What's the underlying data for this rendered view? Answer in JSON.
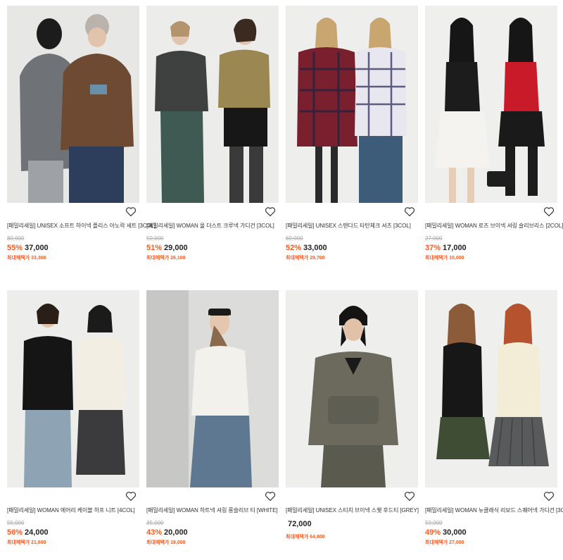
{
  "products": [
    {
      "title": "[패밀리세일] UNISEX 소프트 하이넥 플리스 아노락 세트 [3COL]",
      "original_price": "82,000",
      "discount": "55%",
      "price": "37,000",
      "benefit": "최대혜택가 33,300"
    },
    {
      "title": "[패밀리세일] WOMAN 울 더스트 크루넥 가디건 [3COL]",
      "original_price": "59,000",
      "discount": "51%",
      "price": "29,000",
      "benefit": "최대혜택가 26,100"
    },
    {
      "title": "[패밀리세일] UNISEX 스탠다드 타탄체크 셔츠 [3COL]",
      "original_price": "69,000",
      "discount": "52%",
      "price": "33,000",
      "benefit": "최대혜택가 29,700"
    },
    {
      "title": "[패밀리세일] WOMAN 로즈 브이넥 셔링 슬리브리스 [2COL]",
      "original_price": "27,000",
      "discount": "37%",
      "price": "17,000",
      "benefit": "최대혜택가 15,000"
    },
    {
      "title": "[패밀리세일] WOMAN 에어리 케이블 하프 니트 [4COL]",
      "original_price": "55,000",
      "discount": "56%",
      "price": "24,000",
      "benefit": "최대혜택가 21,600"
    },
    {
      "title": "[패밀리세일] WOMAN 하트넥 셔링 롱슬리브 티 [WHITE]",
      "original_price": "35,000",
      "discount": "43%",
      "price": "20,000",
      "benefit": "최대혜택가 18,000"
    },
    {
      "title": "[패밀리세일] UNISEX 스티치 브이넥 스웻 후드티 [GREY]",
      "original_price": "",
      "discount": "",
      "price": "72,000",
      "benefit": "최대혜택가 64,800"
    },
    {
      "title": "[패밀리세일] WOMAN 뉴클래식 리보드 스퀘어넥 가디건 [3COL]",
      "original_price": "59,000",
      "discount": "49%",
      "price": "30,000",
      "benefit": "최대혜택가 27,000"
    }
  ],
  "icons": {
    "wishlist": "heart-outline-icon"
  },
  "colors": {
    "discount": "#ff5a1f",
    "price": "#222222",
    "original": "#aaaaaa"
  }
}
